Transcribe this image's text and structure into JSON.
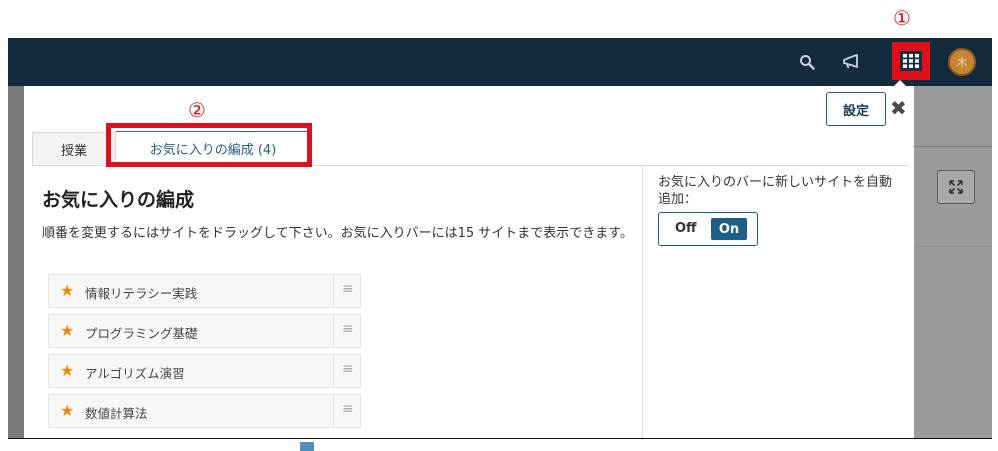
{
  "markers": {
    "one": "①",
    "two": "②"
  },
  "topbar": {
    "icons": [
      "search-icon",
      "megaphone-icon",
      "apps-grid-icon",
      "avatar"
    ],
    "avatar_text": "木"
  },
  "panel": {
    "settings_label": "設定",
    "close_symbol": "✖",
    "tabs": [
      {
        "label": "授業"
      },
      {
        "label": "お気に入りの編成 (4)"
      }
    ],
    "heading": "お気に入りの編成",
    "description": "順番を変更するにはサイトをドラッグして下さい。お気に入りバーには15 サイトまで表示できます。",
    "favorites": [
      {
        "name": "情報リテラシー実践"
      },
      {
        "name": "プログラミング基礎"
      },
      {
        "name": "アルゴリズム演習"
      },
      {
        "name": "数値計算法"
      }
    ],
    "auto_add_label": "お気に入りのバーに新しいサイトを自動追加：",
    "toggle": {
      "off": "Off",
      "on": "On",
      "selected": "On"
    }
  },
  "colors": {
    "accent": "#1e5f86",
    "highlight_red": "#e0101a",
    "topbar": "#142b3d",
    "star": "#e38d10"
  }
}
